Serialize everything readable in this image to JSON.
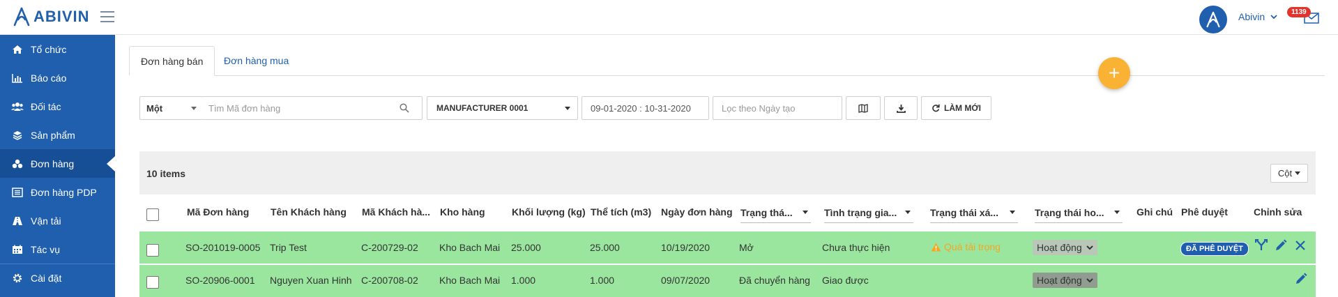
{
  "brand": {
    "name": "ABIVIN",
    "color": "#1f5fae"
  },
  "user": {
    "name": "Abivin",
    "notifications": "1139"
  },
  "sidebar": {
    "items": [
      {
        "label": "Tổ chức",
        "icon": "home-icon"
      },
      {
        "label": "Báo cáo",
        "icon": "bar-chart-icon"
      },
      {
        "label": "Đối tác",
        "icon": "users-icon"
      },
      {
        "label": "Sản phẩm",
        "icon": "cubes-icon"
      },
      {
        "label": "Đơn hàng",
        "icon": "boxes-icon",
        "active": true
      },
      {
        "label": "Đơn hàng PDP",
        "icon": "list-icon"
      },
      {
        "label": "Vận tải",
        "icon": "road-icon"
      },
      {
        "label": "Tác vụ",
        "icon": "calendar-icon"
      },
      {
        "label": "Cài đặt",
        "icon": "gear-icon"
      }
    ]
  },
  "tabs": {
    "sales": "Đơn hàng bán",
    "purchase": "Đơn hàng mua"
  },
  "filters": {
    "mode": "Một",
    "search_placeholder": "Tìm Mã đơn hàng",
    "manufacturer": "MANUFACTURER 0001",
    "date_range": "09-01-2020 : 10-31-2020",
    "created_placeholder": "Lọc theo Ngày tạo",
    "refresh_label": "LÀM MỚI"
  },
  "grid": {
    "items_count": "10 items",
    "columns_button": "Cột",
    "headers": {
      "order_code": "Mã Đơn hàng",
      "customer_name": "Tên Khách hàng",
      "customer_code": "Mã Khách hà...",
      "warehouse": "Kho hàng",
      "weight": "Khối lượng (kg)",
      "volume": "Thể tích (m3)",
      "order_date": "Ngày đơn hàng",
      "status": "Trạng thá...",
      "delivery_status": "Tình trạng gia...",
      "confirm_status": "Trạng thái xá...",
      "active_status": "Trạng thái ho...",
      "note": "Ghi chú",
      "approval": "Phê duyệt",
      "edit": "Chỉnh sửa"
    },
    "rows": [
      {
        "order_code": "SO-201019-0005",
        "customer_name": "Trip Test",
        "customer_code": "C-200729-02",
        "warehouse": "Kho Bach Mai",
        "weight": "25.000",
        "volume": "25.000",
        "order_date": "10/19/2020",
        "status": "Mở",
        "delivery_status": "Chưa thực hiện",
        "confirm_status": "Quá tải trọng",
        "active_status": "Hoạt động",
        "approval": "ĐÃ PHÊ DUYỆT"
      },
      {
        "order_code": "SO-20906-0001",
        "customer_name": "Nguyen Xuan Hinh",
        "customer_code": "C-200708-02",
        "warehouse": "Kho Bach Mai",
        "weight": "1.000",
        "volume": "1.000",
        "order_date": "09/07/2020",
        "status": "Đã chuyển hàng",
        "delivery_status": "Giao được",
        "confirm_status": "",
        "active_status": "Hoạt động",
        "approval": ""
      }
    ]
  },
  "colors": {
    "row_bg": "#9ae69f",
    "fab": "#f9b233",
    "warning": "#f5a623"
  }
}
